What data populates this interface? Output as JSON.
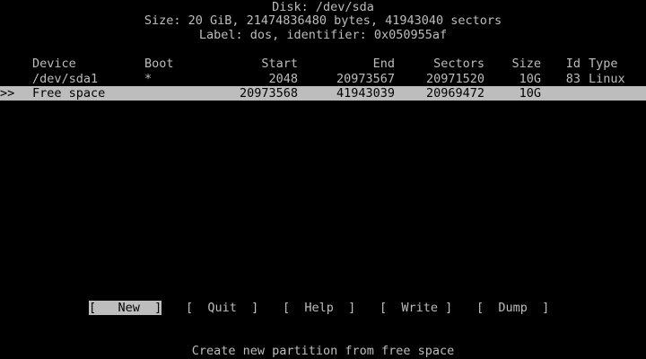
{
  "disk": {
    "title": "Disk: /dev/sda",
    "size_line": "Size: 20 GiB, 21474836480 bytes, 41943040 sectors",
    "label_line": "Label: dos, identifier: 0x050955af"
  },
  "table": {
    "headers": {
      "device": "Device",
      "boot": "Boot",
      "start": "Start",
      "end": "End",
      "sectors": "Sectors",
      "size": "Size",
      "id": "Id",
      "type": "Type"
    },
    "rows": [
      {
        "cursor": "",
        "device": "/dev/sda1",
        "boot": "*",
        "start": "2048",
        "end": "20973567",
        "sectors": "20971520",
        "size": "10G",
        "id": "83",
        "type": "Linux"
      },
      {
        "cursor": ">>",
        "device": "Free space",
        "boot": "",
        "start": "20973568",
        "end": "41943039",
        "sectors": "20969472",
        "size": "10G",
        "id": "",
        "type": ""
      }
    ]
  },
  "menu": {
    "items": [
      "[   New  ]",
      "[  Quit  ]",
      "[  Help  ]",
      "[  Write ]",
      "[  Dump  ]"
    ],
    "selected_index": 0
  },
  "status": "Create new partition from free space",
  "colors": {
    "background": "#000000",
    "foreground": "#bdbdbd",
    "highlight": "#bdbdbd"
  }
}
